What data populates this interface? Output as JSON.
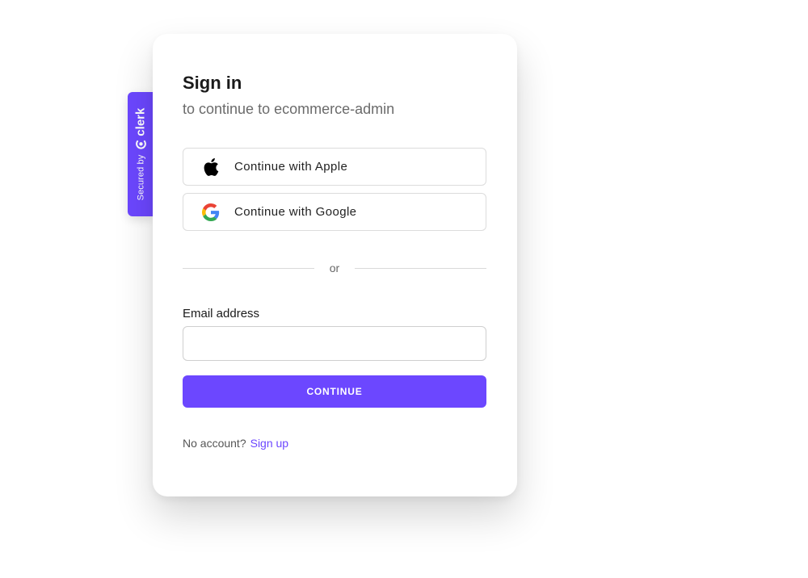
{
  "badge": {
    "secured_by": "Secured by",
    "brand": "clerk"
  },
  "signin": {
    "title": "Sign in",
    "subtitle": "to continue to ecommerce-admin",
    "apple_label": "Continue with Apple",
    "google_label": "Continue with Google",
    "divider_text": "or",
    "email_label": "Email address",
    "email_value": "",
    "email_placeholder": "",
    "continue_label": "CONTINUE",
    "no_account_text": "No account?",
    "signup_link": "Sign up"
  },
  "icons": {
    "apple": "apple-icon",
    "google": "google-icon",
    "clerk": "clerk-logo-icon"
  },
  "colors": {
    "accent": "#6C47FF",
    "text": "#1a1a1a",
    "muted": "#6b6b6b"
  }
}
